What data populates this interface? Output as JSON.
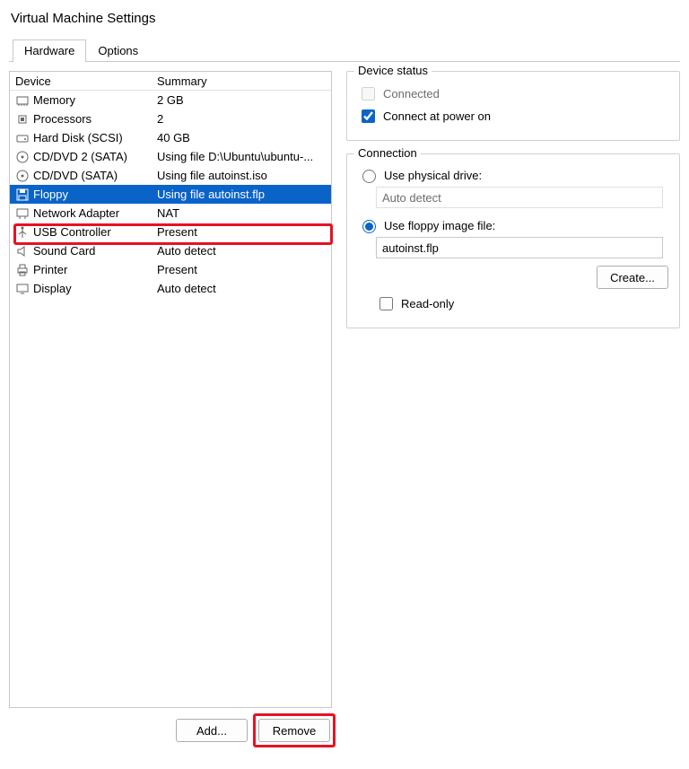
{
  "window": {
    "title": "Virtual Machine Settings"
  },
  "tabs": {
    "hardware": "Hardware",
    "options": "Options",
    "active": "hardware"
  },
  "list": {
    "headers": {
      "device": "Device",
      "summary": "Summary"
    },
    "rows": [
      {
        "icon": "memory",
        "device": "Memory",
        "summary": "2 GB"
      },
      {
        "icon": "cpu",
        "device": "Processors",
        "summary": "2"
      },
      {
        "icon": "hdd",
        "device": "Hard Disk (SCSI)",
        "summary": "40 GB"
      },
      {
        "icon": "disc",
        "device": "CD/DVD 2 (SATA)",
        "summary": "Using file D:\\Ubuntu\\ubuntu-..."
      },
      {
        "icon": "disc",
        "device": "CD/DVD (SATA)",
        "summary": "Using file autoinst.iso"
      },
      {
        "icon": "floppy",
        "device": "Floppy",
        "summary": "Using file autoinst.flp",
        "selected": true
      },
      {
        "icon": "net",
        "device": "Network Adapter",
        "summary": "NAT"
      },
      {
        "icon": "usb",
        "device": "USB Controller",
        "summary": "Present"
      },
      {
        "icon": "sound",
        "device": "Sound Card",
        "summary": "Auto detect"
      },
      {
        "icon": "printer",
        "device": "Printer",
        "summary": "Present"
      },
      {
        "icon": "display",
        "device": "Display",
        "summary": "Auto detect"
      }
    ]
  },
  "buttons": {
    "add": "Add...",
    "remove": "Remove",
    "create": "Create..."
  },
  "right": {
    "group_status": "Device status",
    "connected": "Connected",
    "connect_poweron": "Connect at power on",
    "group_connection": "Connection",
    "use_physical": "Use physical drive:",
    "physical_value": "Auto detect",
    "use_image": "Use floppy image file:",
    "image_value": "autoinst.flp",
    "readonly": "Read-only"
  },
  "state": {
    "connected_checked": false,
    "connect_poweron_checked": true,
    "conn_mode": "image",
    "readonly_checked": false
  }
}
